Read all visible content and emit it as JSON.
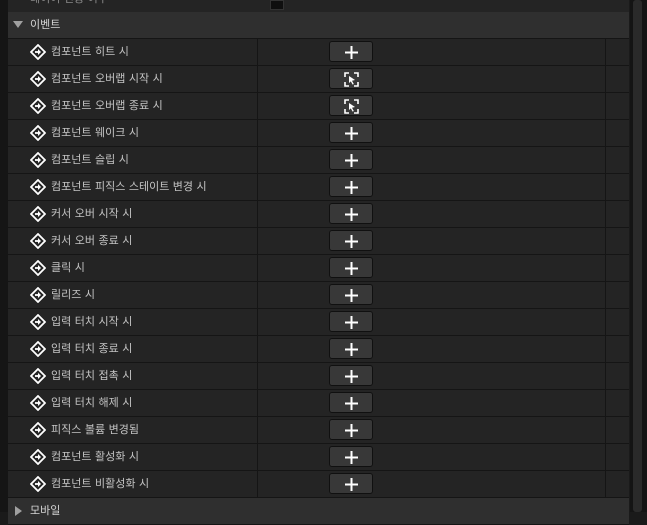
{
  "top_partial_row": {
    "label": "레이어 전용 여부"
  },
  "events_section": {
    "title": "이벤트",
    "items": [
      {
        "label": "컴포넌트 히트 시",
        "button_icon": "plus-icon"
      },
      {
        "label": "컴포넌트 오버랩 시작 시",
        "button_icon": "focus-select-icon"
      },
      {
        "label": "컴포넌트 오버랩 종료 시",
        "button_icon": "focus-select-icon"
      },
      {
        "label": "컴포넌트 웨이크 시",
        "button_icon": "plus-icon"
      },
      {
        "label": "컴포넌트 슬립 시",
        "button_icon": "plus-icon"
      },
      {
        "label": "컴포넌트 피직스 스테이트 변경 시",
        "button_icon": "plus-icon"
      },
      {
        "label": "커서 오버 시작 시",
        "button_icon": "plus-icon"
      },
      {
        "label": "커서 오버 종료 시",
        "button_icon": "plus-icon"
      },
      {
        "label": "클릭 시",
        "button_icon": "plus-icon"
      },
      {
        "label": "릴리즈 시",
        "button_icon": "plus-icon"
      },
      {
        "label": "입력 터치 시작 시",
        "button_icon": "plus-icon"
      },
      {
        "label": "입력 터치 종료 시",
        "button_icon": "plus-icon"
      },
      {
        "label": "입력 터치 접촉 시",
        "button_icon": "plus-icon"
      },
      {
        "label": "입력 터치 해제 시",
        "button_icon": "plus-icon"
      },
      {
        "label": "피직스 볼륨 변경됨",
        "button_icon": "plus-icon"
      },
      {
        "label": "컴포넌트 활성화 시",
        "button_icon": "plus-icon"
      },
      {
        "label": "컴포넌트 비활성화 시",
        "button_icon": "plus-icon"
      }
    ]
  },
  "mobile_section": {
    "title": "모바일"
  },
  "colors": {
    "background": "#1a1a1a",
    "row": "#242424",
    "section_header": "#2f2f2f",
    "button": "#383838",
    "icon": "#ffffff"
  }
}
